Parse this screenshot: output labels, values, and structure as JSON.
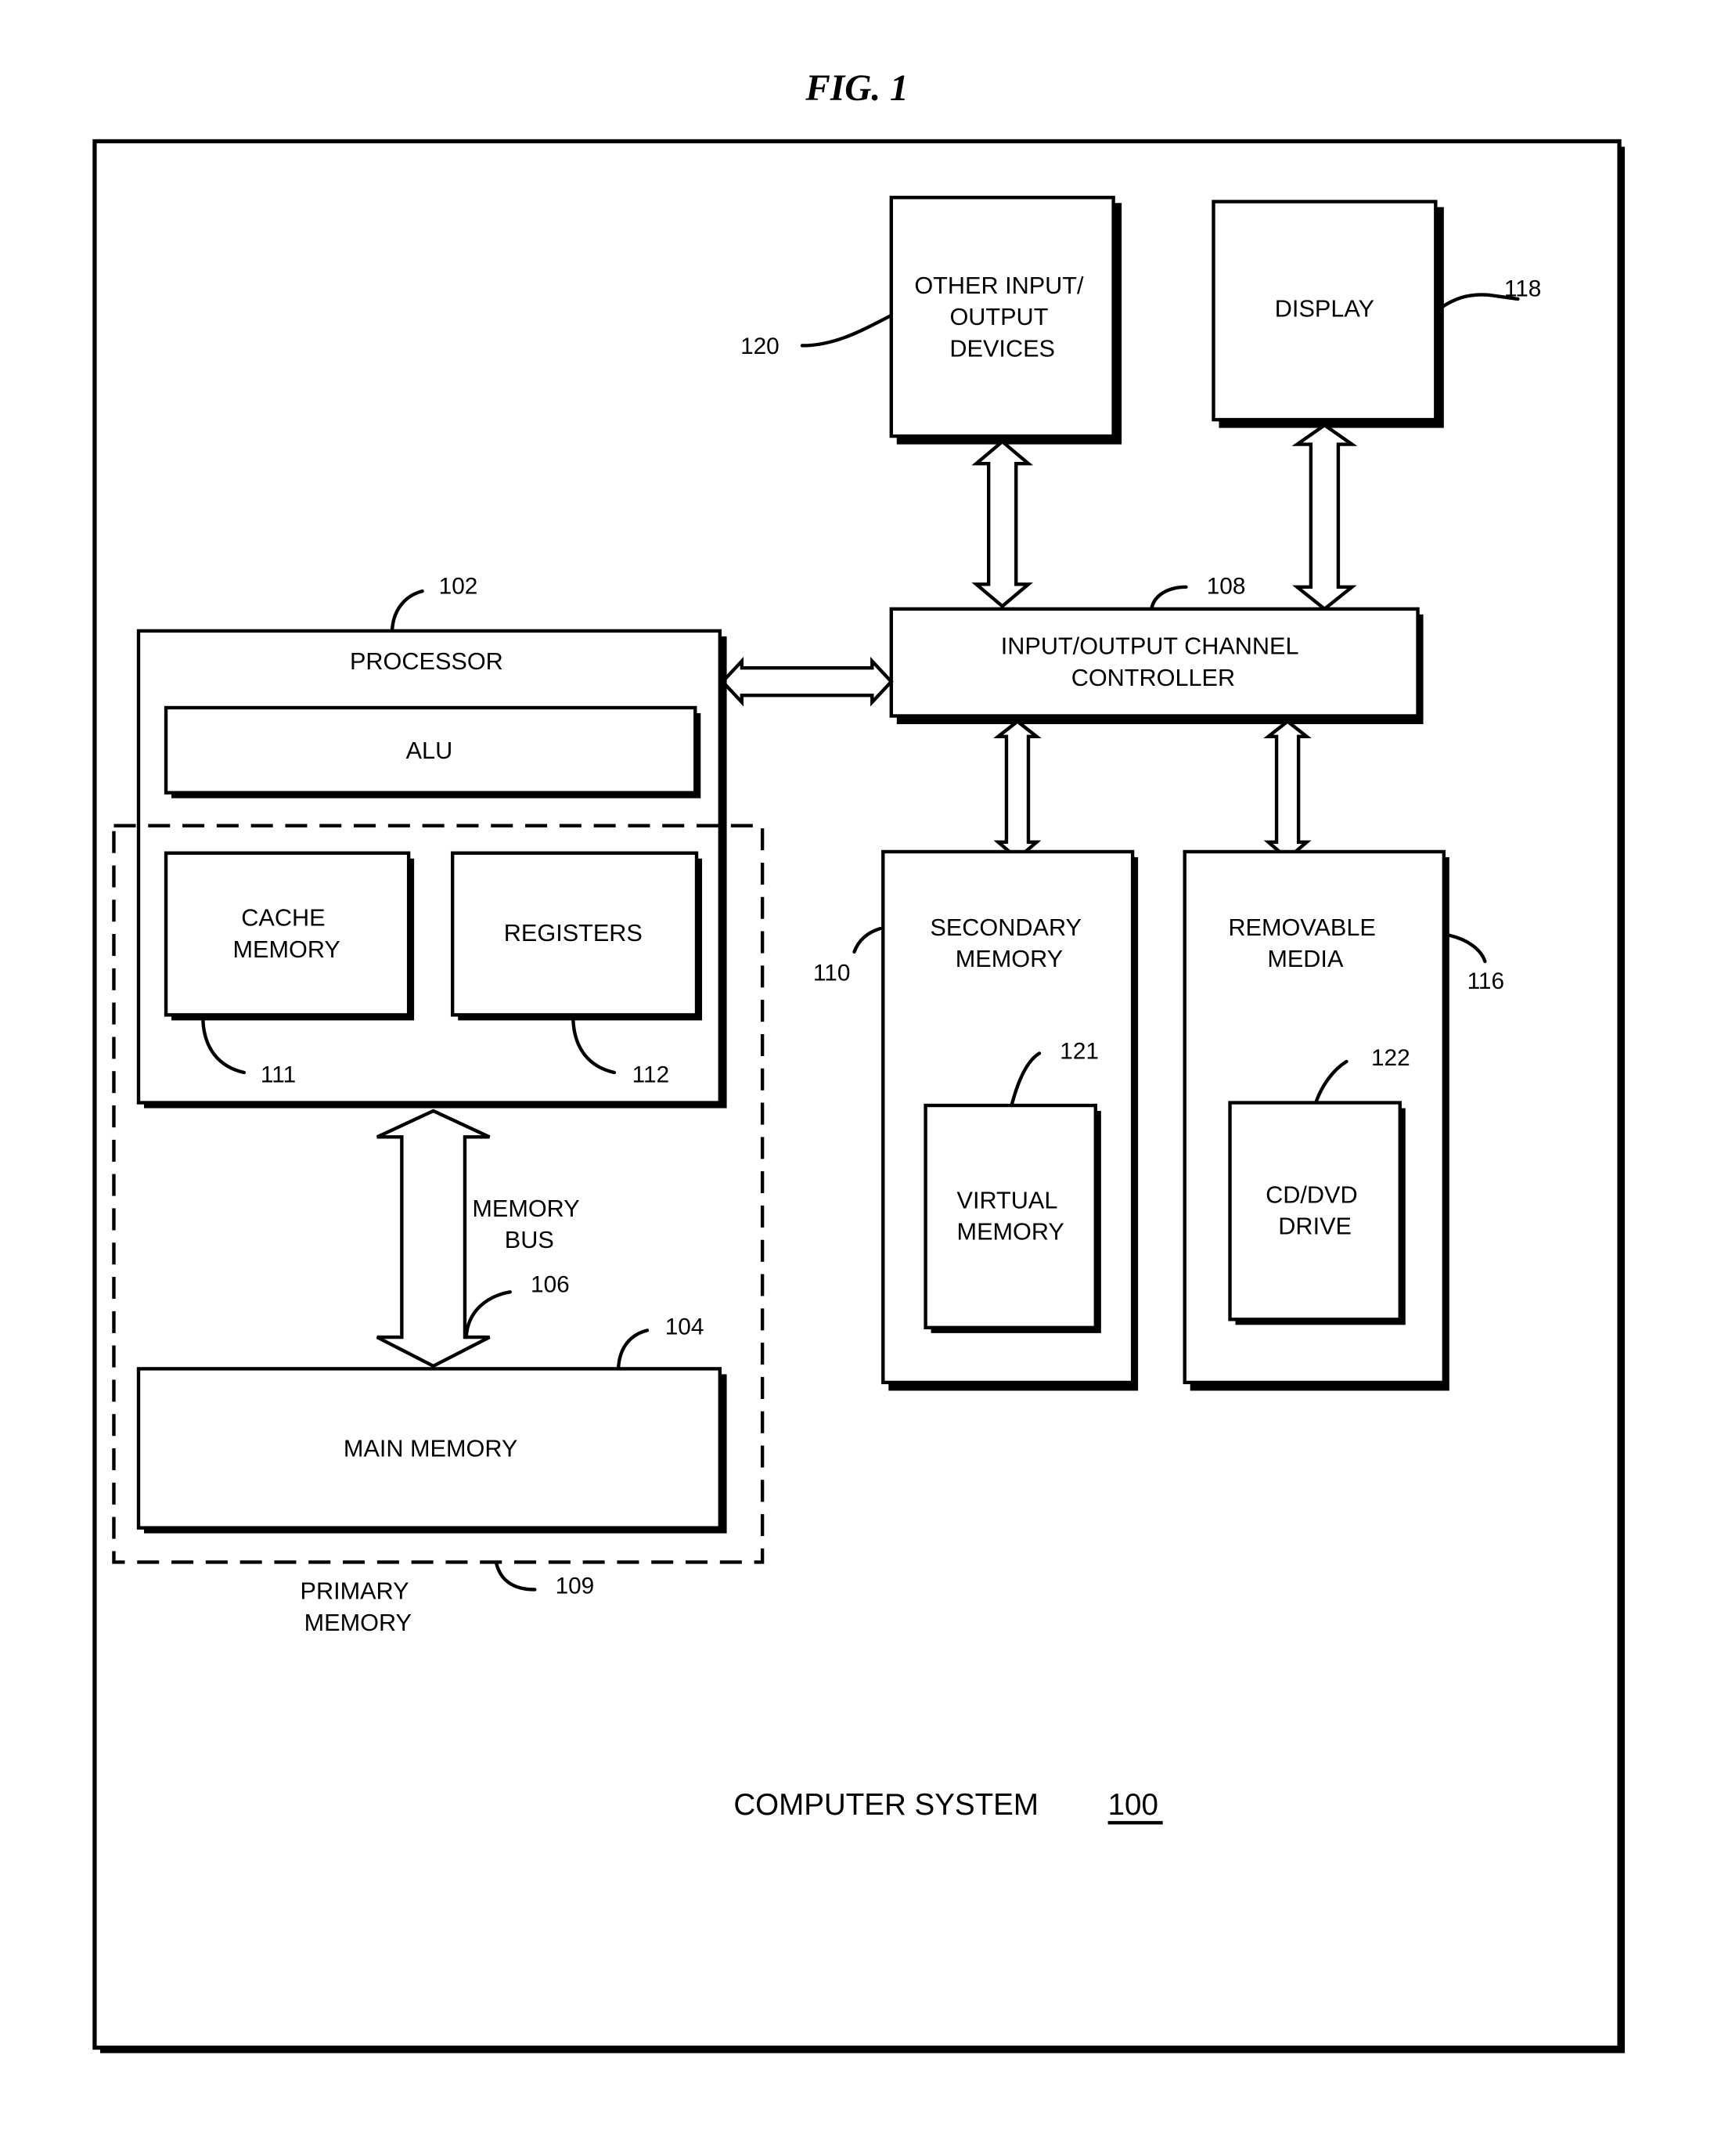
{
  "figure": {
    "title": "FIG. 1",
    "caption": "COMPUTER SYSTEM",
    "caption_ref": "100"
  },
  "blocks": {
    "processor": {
      "label": "PROCESSOR",
      "ref": "102"
    },
    "alu": {
      "label": "ALU"
    },
    "cache_memory": {
      "lines": [
        "CACHE",
        "MEMORY"
      ],
      "ref": "111"
    },
    "registers": {
      "label": "REGISTERS",
      "ref": "112"
    },
    "memory_bus": {
      "lines": [
        "MEMORY",
        "BUS"
      ],
      "ref": "106"
    },
    "main_memory": {
      "label": "MAIN MEMORY",
      "ref": "104"
    },
    "primary_memory": {
      "lines": [
        "PRIMARY",
        "MEMORY"
      ],
      "ref": "109"
    },
    "io_controller": {
      "lines": [
        "INPUT/OUTPUT CHANNEL",
        "CONTROLLER"
      ],
      "ref": "108"
    },
    "other_io": {
      "lines": [
        "OTHER INPUT/",
        "OUTPUT",
        "DEVICES"
      ],
      "ref": "120"
    },
    "display": {
      "label": "DISPLAY",
      "ref": "118"
    },
    "secondary_memory": {
      "lines": [
        "SECONDARY",
        "MEMORY"
      ],
      "ref": "110"
    },
    "virtual_memory": {
      "lines": [
        "VIRTUAL",
        "MEMORY"
      ],
      "ref": "121"
    },
    "removable_media": {
      "lines": [
        "REMOVABLE",
        "MEDIA"
      ],
      "ref": "116"
    },
    "cd_dvd_drive": {
      "lines": [
        "CD/DVD",
        "DRIVE"
      ],
      "ref": "122"
    }
  }
}
